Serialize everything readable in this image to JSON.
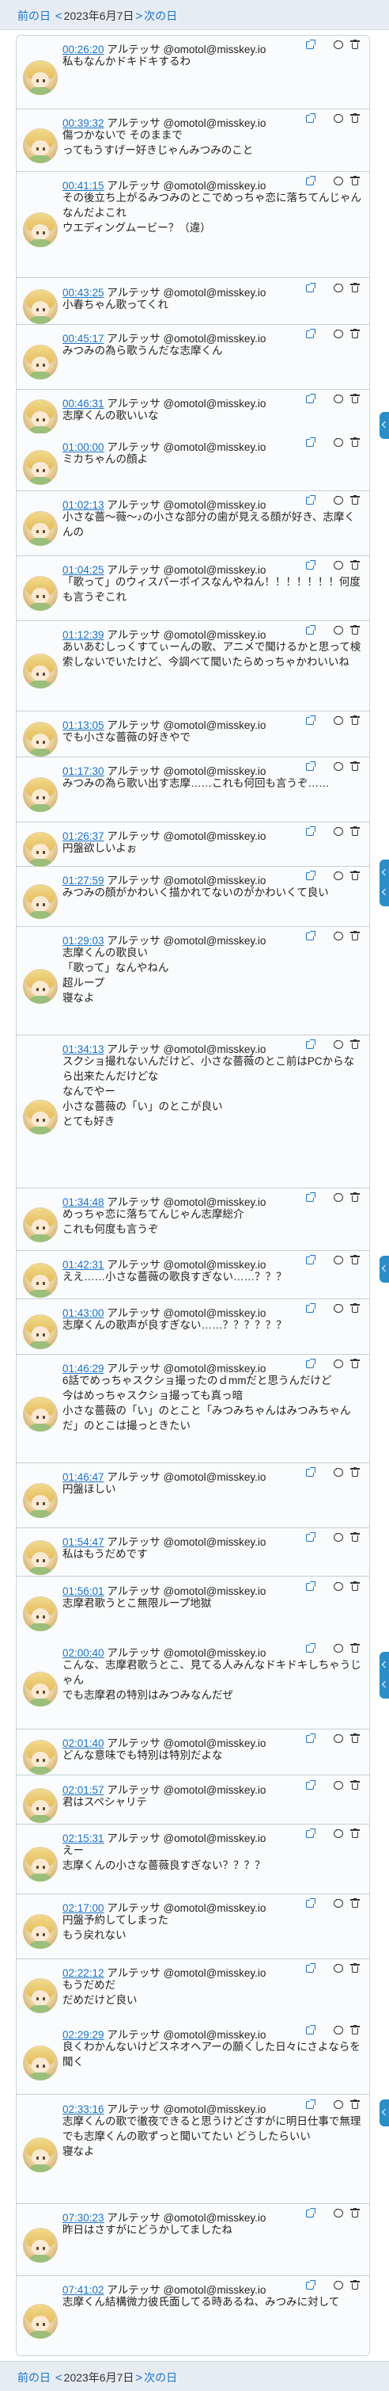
{
  "nav": {
    "prev_label": "前の日",
    "next_label": "次の日",
    "date": "2023年6月7日",
    "chevron_prev": "<",
    "chevron_next": ">"
  },
  "colors": {
    "link": "#1a73c8",
    "side_tab": "#2a8ec9",
    "bar_bg": "#e6ecf2"
  },
  "posts": [
    {
      "time": "00:26:20",
      "user": "アルテッサ @omotol@misskey.io",
      "text": "私もなんかドキドキするわ"
    },
    {
      "time": "00:39:32",
      "user": "アルテッサ @omotol@misskey.io",
      "text": "傷つかないで そのままで\nってもうすげー好きじゃんみつみのこと"
    },
    {
      "time": "00:41:15",
      "user": "アルテッサ @omotol@misskey.io",
      "text": "その後立ち上がるみつみのとこでめっちゃ恋に落ちてんじゃん\nなんだよこれ\nウエディングムービー？（違）"
    },
    {
      "time": "00:43:25",
      "user": "アルテッサ @omotol@misskey.io",
      "text": "小春ちゃん歌ってくれ"
    },
    {
      "time": "00:45:17",
      "user": "アルテッサ @omotol@misskey.io",
      "text": "みつみの為ら歌うんだな志摩くん"
    },
    {
      "time": "00:46:31",
      "user": "アルテッサ @omotol@misskey.io",
      "text": "志摩くんの歌いいな"
    },
    {
      "time": "01:00:00",
      "user": "アルテッサ @omotol@misskey.io",
      "text": "ミカちゃんの顔よ"
    },
    {
      "time": "01:02:13",
      "user": "アルテッサ @omotol@misskey.io",
      "text": "小さな薔〜薇〜♪の小さな部分の歯が見える顔が好き、志摩くんの"
    },
    {
      "time": "01:04:25",
      "user": "アルテッサ @omotol@misskey.io",
      "text": "「歌って」のウィスパーボイスなんやねん！！！！！！！何度も言うぞこれ"
    },
    {
      "time": "01:12:39",
      "user": "アルテッサ @omotol@misskey.io",
      "text": "あいあむしっくすてぃーんの歌、アニメで聞けるかと思って検索しないでいたけど、今調べて聞いたらめっちゃかわいいね"
    },
    {
      "time": "01:13:05",
      "user": "アルテッサ @omotol@misskey.io",
      "text": "でも小さな薔薇の好きやで"
    },
    {
      "time": "01:17:30",
      "user": "アルテッサ @omotol@misskey.io",
      "text": "みつみの為ら歌い出す志摩……これも何回も言うぞ……"
    },
    {
      "time": "01:26:37",
      "user": "アルテッサ @omotol@misskey.io",
      "text": "円盤欲しいよぉ"
    },
    {
      "time": "01:27:59",
      "user": "アルテッサ @omotol@misskey.io",
      "text": "みつみの顔がかわいく描かれてないのがかわいくて良い"
    },
    {
      "time": "01:29:03",
      "user": "アルテッサ @omotol@misskey.io",
      "text": "志摩くんの歌良い\n「歌って」なんやねん\n超ループ\n寝なよ"
    },
    {
      "time": "01:34:13",
      "user": "アルテッサ @omotol@misskey.io",
      "text": "スクショ撮れないんだけど、小さな薔薇のとこ前はPCからなら出来たんだけどな\nなんでやー\n小さな薔薇の「い」のとこが良い\nとても好き"
    },
    {
      "time": "01:34:48",
      "user": "アルテッサ @omotol@misskey.io",
      "text": "めっちゃ恋に落ちてんじゃん志摩総介\nこれも何度も言うぞ"
    },
    {
      "time": "01:42:31",
      "user": "アルテッサ @omotol@misskey.io",
      "text": "ええ……小さな薔薇の歌良すぎない……？？？"
    },
    {
      "time": "01:43:00",
      "user": "アルテッサ @omotol@misskey.io",
      "text": "志摩くんの歌声が良すぎない……？？？？？？"
    },
    {
      "time": "01:46:29",
      "user": "アルテッサ @omotol@misskey.io",
      "text": "6話でめっちゃスクショ撮ったのｄmmだと思うんだけど\n今はめっちゃスクショ撮っても真っ暗\n小さな薔薇の「い」のとこと「みつみちゃんはみつみちゃんだ」のとこは撮っときたい"
    },
    {
      "time": "01:46:47",
      "user": "アルテッサ @omotol@misskey.io",
      "text": "円盤ほしい"
    },
    {
      "time": "01:54:47",
      "user": "アルテッサ @omotol@misskey.io",
      "text": "私はもうだめです"
    },
    {
      "time": "01:56:01",
      "user": "アルテッサ @omotol@misskey.io",
      "text": "志摩君歌うとこ無限ループ地獄"
    },
    {
      "time": "02:00:40",
      "user": "アルテッサ @omotol@misskey.io",
      "text": "こんな、志摩君歌うとこ、見てる人みんなドキドキしちゃうじゃん\nでも志摩君の特別はみつみなんだぜ"
    },
    {
      "time": "02:01:40",
      "user": "アルテッサ @omotol@misskey.io",
      "text": "どんな意味でも特別は特別だよな"
    },
    {
      "time": "02:01:57",
      "user": "アルテッサ @omotol@misskey.io",
      "text": "君はスペシャリテ"
    },
    {
      "time": "02:15:31",
      "user": "アルテッサ @omotol@misskey.io",
      "text": "えー\n志摩くんの小さな薔薇良すぎない？？？？"
    },
    {
      "time": "02:17:00",
      "user": "アルテッサ @omotol@misskey.io",
      "text": "円盤予約してしまった\nもう戻れない"
    },
    {
      "time": "02:22:12",
      "user": "アルテッサ @omotol@misskey.io",
      "text": "もうだめだ\nだめだけど良い"
    },
    {
      "time": "02:29:29",
      "user": "アルテッサ @omotol@misskey.io",
      "text": "良くわかんないけどスネオヘアーの願くした日々にさよならを聞く"
    },
    {
      "time": "02:33:16",
      "user": "アルテッサ @omotol@misskey.io",
      "text": "志摩くんの歌で徹夜できると思うけどさすがに明日仕事で無理\nでも志摩くんの歌ずっと聞いてたい どうしたらいい\n寝なよ"
    },
    {
      "time": "07:30:23",
      "user": "アルテッサ @omotol@misskey.io",
      "text": "昨日はさすがにどうかしてましたね"
    },
    {
      "time": "07:41:02",
      "user": "アルテッサ @omotol@misskey.io",
      "text": "志摩くん結構微力彼氏面してる時あるね、みつみに対して"
    }
  ]
}
